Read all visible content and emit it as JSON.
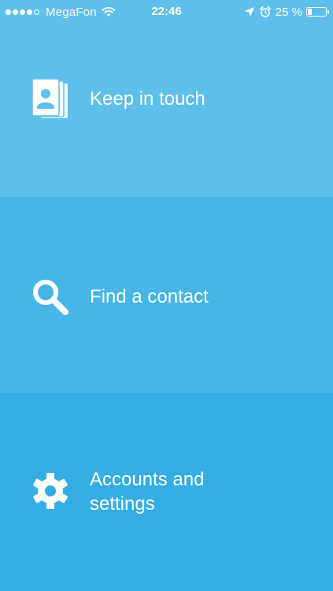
{
  "status_bar": {
    "carrier": "MegaFon",
    "signal_bars_filled": 4,
    "signal_bars_total": 5,
    "time": "22:46",
    "battery_percent_text": "25 %",
    "battery_level": 0.25,
    "icons": [
      "wifi-icon",
      "location-arrow-icon",
      "alarm-clock-icon",
      "battery-icon"
    ]
  },
  "menu": {
    "items": [
      {
        "label": "Keep in touch",
        "icon": "contact-cards-icon",
        "color": "#5cc0eb"
      },
      {
        "label": "Find a contact",
        "icon": "search-icon",
        "color": "#46b6e6"
      },
      {
        "label": "Accounts and settings",
        "icon": "gear-icon",
        "color": "#34ade4"
      }
    ]
  },
  "colors": {
    "text": "#ffffff"
  }
}
